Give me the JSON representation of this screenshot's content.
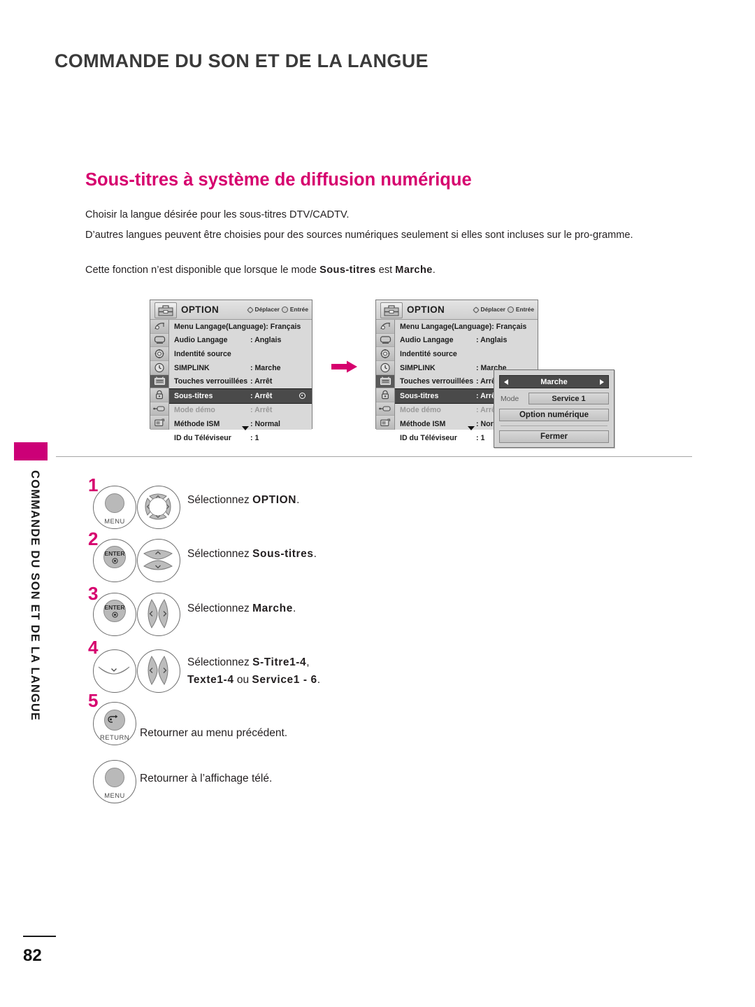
{
  "header": {
    "title": "COMMANDE DU SON ET DE LA LANGUE"
  },
  "sidebar": {
    "vertical_label": "COMMANDE DU SON ET DE LA LANGUE",
    "tab_color": "#cc0077"
  },
  "footer": {
    "page_number": "82"
  },
  "section": {
    "heading": "Sous-titres à système de diffusion numérique",
    "heading_color": "#d6006e",
    "paragraphs": {
      "p1": "Choisir la langue désirée pour les sous-titres DTV/CADTV.",
      "p2": "D’autres langues peuvent être choisies pour des sources numériques seulement si elles sont incluses sur le pro-gramme.",
      "p3_prefix": "Cette fonction n’est disponible que lorsque le mode ",
      "p3_bold1": "Sous-titres",
      "p3_mid": " est ",
      "p3_bold2": "Marche",
      "p3_suffix": "."
    }
  },
  "osd": {
    "title": "OPTION",
    "hint_move": "Déplacer",
    "hint_enter": "Entrée",
    "rows": [
      {
        "label": "Menu Langage(Language): Français",
        "value": "",
        "state": "normal",
        "inline": true
      },
      {
        "label": "Audio Langage",
        "value": ": Anglais",
        "state": "normal"
      },
      {
        "label": "Indentité source",
        "value": "",
        "state": "normal"
      },
      {
        "label": "SIMPLINK",
        "value": ": Marche",
        "state": "normal"
      },
      {
        "label": "Touches verrouillées",
        "value": ": Arrêt",
        "state": "normal"
      },
      {
        "label": "Sous-titres",
        "value": ": Arrêt",
        "state": "selected"
      },
      {
        "label": "Mode démo",
        "value": ": Arrêt",
        "state": "dim"
      },
      {
        "label": "Méthode ISM",
        "value": ": Normal",
        "state": "normal"
      },
      {
        "label": "ID du Téléviseur",
        "value": ": 1",
        "state": "normal"
      }
    ],
    "icons": [
      "picture-icon",
      "screen-icon",
      "audio-icon",
      "time-icon",
      "option-icon",
      "lock-icon",
      "connection-icon",
      "usb-icon"
    ],
    "header_icon": "toolbox-icon",
    "active_icon_index": 4
  },
  "popup": {
    "value": "Marche",
    "mode_label": "Mode",
    "mode_value": "Service 1",
    "digital_option": "Option numérique",
    "close": "Fermer",
    "left_arrow": "left-arrow-icon",
    "right_arrow": "right-arrow-icon"
  },
  "flow": {
    "arrow": "right-arrow-icon",
    "arrow_color": "#d6006e"
  },
  "steps": [
    {
      "num": "1",
      "button_label": "MENU",
      "pad": "four-way-pad",
      "text_prefix": "Sélectionnez ",
      "text_bold": "OPTION",
      "text_suffix": "."
    },
    {
      "num": "2",
      "button_label": "ENTER",
      "pad": "up-down-pad",
      "text_prefix": "Sélectionnez ",
      "text_bold": "Sous-titres",
      "text_suffix": "."
    },
    {
      "num": "3",
      "button_label": "ENTER",
      "pad": "left-right-pad",
      "text_prefix": "Sélectionnez ",
      "text_bold": "Marche",
      "text_suffix": "."
    },
    {
      "num": "4",
      "button_label": "",
      "pad": "down-pad",
      "text_prefix": "Sélectionnez ",
      "text_bold": "S-Titre1-4",
      "text_suffix": ",",
      "text_line2_bold1": "Texte1-4",
      "text_line2_mid": " ou ",
      "text_line2_bold2": "Service1 - 6",
      "text_line2_suffix": "."
    },
    {
      "num": "5",
      "button_label": "RETURN",
      "pad": "",
      "text_plain": "Retourner au menu précédent."
    },
    {
      "num": "",
      "button_label": "MENU",
      "pad": "",
      "text_plain": "Retourner à l’affichage télé."
    }
  ]
}
